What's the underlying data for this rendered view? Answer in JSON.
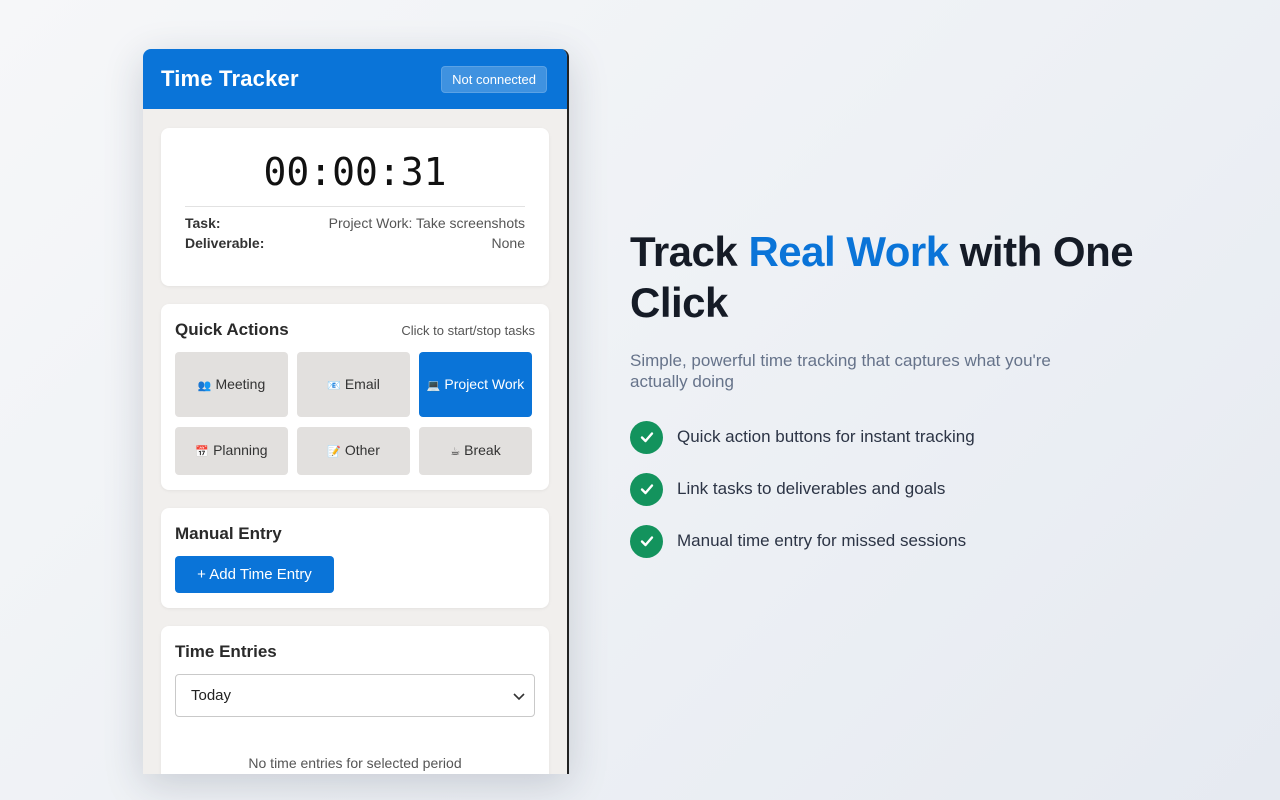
{
  "popup": {
    "title": "Time Tracker",
    "connection_status": "Not connected",
    "timer": {
      "display": "00:00:31",
      "task_label": "Task:",
      "task_value": "Project Work: Take screenshots",
      "deliverable_label": "Deliverable:",
      "deliverable_value": "None"
    },
    "quick_actions": {
      "title": "Quick Actions",
      "hint": "Click to start/stop tasks",
      "buttons": [
        {
          "icon": "👥",
          "icon_name": "people-icon",
          "label": "Meeting",
          "active": false
        },
        {
          "icon": "📧",
          "icon_name": "email-icon",
          "label": "Email",
          "active": false
        },
        {
          "icon": "💻",
          "icon_name": "laptop-icon",
          "label": "Project Work",
          "active": true
        },
        {
          "icon": "📅",
          "icon_name": "calendar-icon",
          "label": "Planning",
          "active": false
        },
        {
          "icon": "📝",
          "icon_name": "memo-icon",
          "label": "Other",
          "active": false
        },
        {
          "icon": "☕",
          "icon_name": "coffee-icon",
          "label": "Break",
          "active": false
        }
      ]
    },
    "manual_entry": {
      "title": "Manual Entry",
      "add_button": "+ Add Time Entry"
    },
    "time_entries": {
      "title": "Time Entries",
      "period_selected": "Today",
      "empty_message": "No time entries for selected period"
    }
  },
  "hero": {
    "headline_part1": "Track ",
    "headline_accent": "Real Work",
    "headline_part2": " with One Click",
    "subhead": "Simple, powerful time tracking that captures what you're actually doing",
    "features": [
      "Quick action buttons for instant tracking",
      "Link tasks to deliverables and goals",
      "Manual time entry for missed sessions"
    ]
  },
  "colors": {
    "brand_blue": "#0a74d8",
    "check_green": "#13935d",
    "headline_dark": "#151b26"
  }
}
